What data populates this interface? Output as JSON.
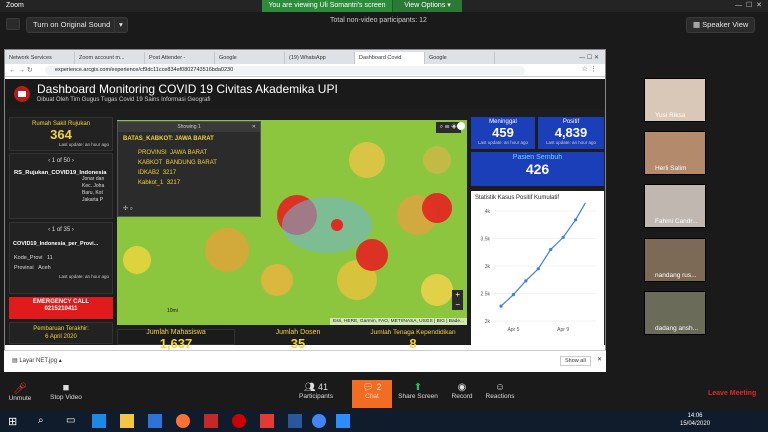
{
  "zoom": {
    "app_title": "Zoom",
    "banner_text": "You are viewing Uli Somantri's screen",
    "view_options": "View Options",
    "audio_button": "Turn on Original Sound",
    "total_participants": "Total non-video participants: 12",
    "speaker_view": "Speaker View",
    "bottom": {
      "unmute": "Unmute",
      "stop_video": "Stop Video",
      "participants": "Participants",
      "participants_count": "41",
      "chat": "Chat",
      "chat_badge": "2",
      "share_screen": "Share Screen",
      "record": "Record",
      "reactions": "Reactions",
      "leave": "Leave Meeting"
    },
    "participants": [
      {
        "name": "Yusi Riksa"
      },
      {
        "name": "Herli Salim"
      },
      {
        "name": "Fahmi Candr..."
      },
      {
        "name": "nandang rus..."
      },
      {
        "name": "dadang ansh..."
      }
    ],
    "accent": "#0e72ed",
    "leave_color": "#e02828"
  },
  "browser": {
    "tabs": [
      "Network Services",
      "Zoom account m...",
      "Post Attender -",
      "Google",
      "(19) WhatsApp",
      "Dashboard Covid",
      "Google"
    ],
    "url": "experience.arcgis.com/experience/cf9dc11cce834ef0802743516bda0230",
    "download_file": "Layar NET.jpg",
    "show_all": "Show all"
  },
  "dashboard": {
    "title": "Dashboard Monitoring COVID 19 Civitas Akademika UPI",
    "subtitle": "Dibuat Oleh Tim Gugus Tugas Covid 19 Sains Informasi Geografi",
    "rumah_sakit_label": "Rumah Sakit Rujukan",
    "rumah_sakit_value": "364",
    "update_text": "Last update: an hour ago",
    "list1_pager": "1 of 50",
    "list1_title": "RS_Rujukan_COVID19_Indonesia",
    "list1_lines": [
      "Jonar dan",
      "Kec. Joha",
      "Baru, Kot",
      "Jakarta P"
    ],
    "list2_pager": "1 of 35",
    "list2_title": "COVID19_Indonesia_per_Provi...",
    "list2_kode_label": "Kode_Provi",
    "list2_kode_value": "11",
    "list2_prov_label": "Provinsi",
    "list2_prov_value": "Aceh",
    "emergency_label": "EMERGENCY CALL",
    "emergency_number": "0215210411",
    "pembaruan_label": "Pembaruan Terakhir:",
    "pembaruan_date": "6 April 2020",
    "popup_showing": "Showing 1",
    "popup_title": "BATAS_KABKOT: JAWA BARAT",
    "popup_rows": [
      {
        "k": "PROVINSI",
        "v": "JAWA BARAT"
      },
      {
        "k": "KABKOT",
        "v": "BANDUNG BARAT"
      },
      {
        "k": "IDKAB2",
        "v": "3217"
      },
      {
        "k": "Kabkot_1",
        "v": "3217"
      }
    ],
    "map_attrib": "Esri, HERE, Garmin, FAO, METI/NASA, USGS | BIG | Bade...",
    "scale_label": "10mi",
    "meninggal_label": "Meninggal",
    "meninggal_value": "459",
    "positif_label": "Positif",
    "positif_value": "4,839",
    "sembuh_label": "Pasien Sembuh",
    "sembuh_value": "426",
    "stats_title": "Statistik Kasus Positif Kumulatif",
    "mahasiswa_label": "Jumlah Mahasiswa",
    "mahasiswa_value": "1,637",
    "dosen_label": "Jumlah Dosen",
    "dosen_value": "35",
    "tendik_label": "Jumlah Tenaga Kependidikan",
    "tendik_value": "8"
  },
  "chart_data": {
    "type": "line",
    "title": "Statistik Kasus Positif Kumulatif",
    "ytick_labels": [
      "2k",
      "2.5k",
      "3k",
      "3.5k",
      "4k"
    ],
    "xtick_labels": [
      "Apr 5",
      "Apr 9"
    ],
    "ylim": [
      2000,
      4000
    ],
    "x": [
      1,
      2,
      3,
      4,
      5,
      6,
      7,
      8
    ],
    "values": [
      2270,
      2480,
      2730,
      2950,
      3300,
      3520,
      3840,
      4230
    ],
    "line_color": "#3d7edb"
  },
  "windows": {
    "time": "14:06",
    "date": "15/04/2020"
  }
}
